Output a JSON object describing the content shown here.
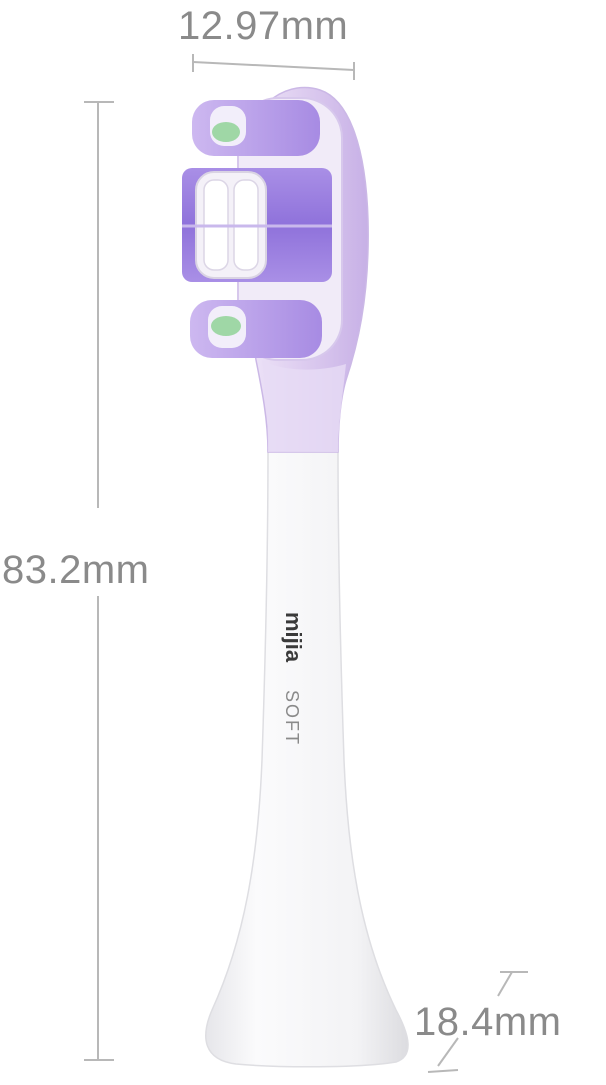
{
  "dimensions": {
    "width": "12.97mm",
    "height": "83.2mm",
    "base": "18.4mm"
  },
  "product": {
    "brand": "mijia",
    "variant": "SOFT"
  },
  "colors": {
    "bristle_purple": "#9b7fe0",
    "bristle_light": "#e4d7f4",
    "bristle_green": "#9fd7a6",
    "head_lavender": "#d9c9ee",
    "handle_white": "#f7f7f8",
    "dimension_line": "#b8b8b8",
    "label_text": "#8a8a8a"
  }
}
